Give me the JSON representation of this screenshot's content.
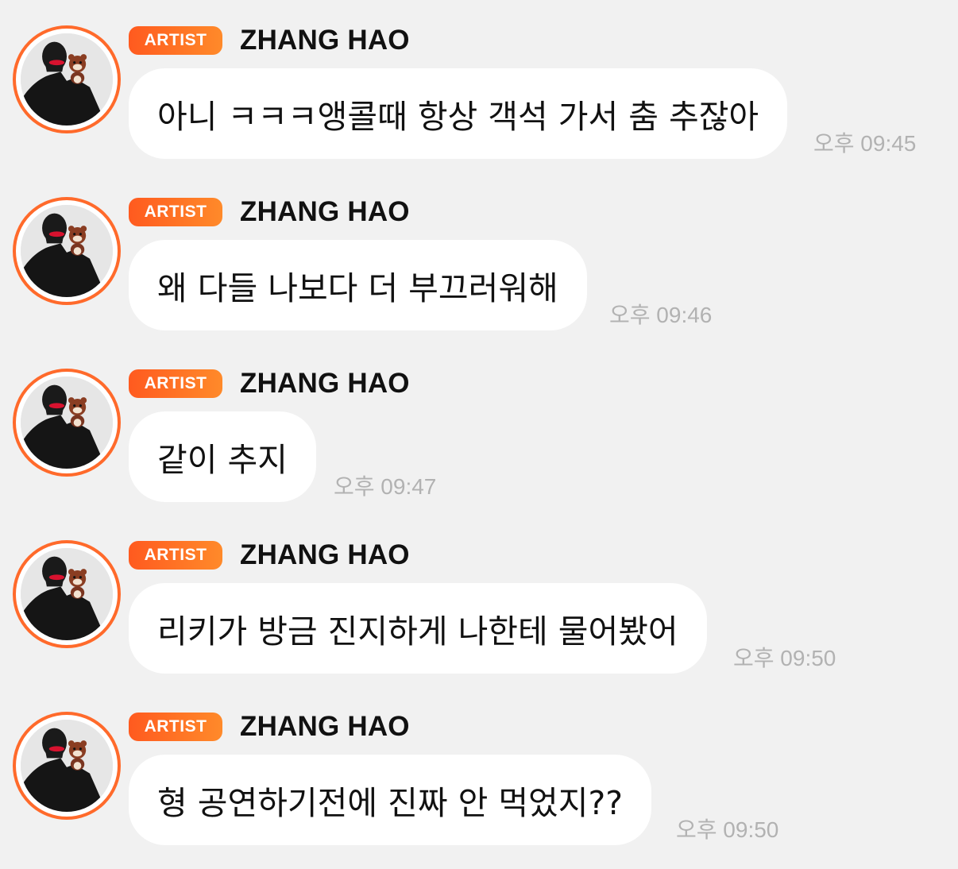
{
  "messages": [
    {
      "badge": "ARTIST",
      "sender": "ZHANG HAO",
      "text": "아니 ㅋㅋㅋ앵콜때 항상 객석 가서 춤 추잖아",
      "time": "오후 09:45"
    },
    {
      "badge": "ARTIST",
      "sender": "ZHANG HAO",
      "text": "왜 다들 나보다 더 부끄러워해",
      "time": "오후 09:46"
    },
    {
      "badge": "ARTIST",
      "sender": "ZHANG HAO",
      "text": "같이 추지",
      "time": "오후 09:47"
    },
    {
      "badge": "ARTIST",
      "sender": "ZHANG HAO",
      "text": "리키가 방금 진지하게 나한테 물어봤어",
      "time": "오후 09:50"
    },
    {
      "badge": "ARTIST",
      "sender": "ZHANG HAO",
      "text": "형 공연하기전에 진짜 안 먹었지??",
      "time": "오후 09:50"
    }
  ],
  "colors": {
    "background": "#f1f1f1",
    "accent": "#ff6a2b",
    "bubble": "#ffffff",
    "timestamp": "#b2b2b2"
  }
}
